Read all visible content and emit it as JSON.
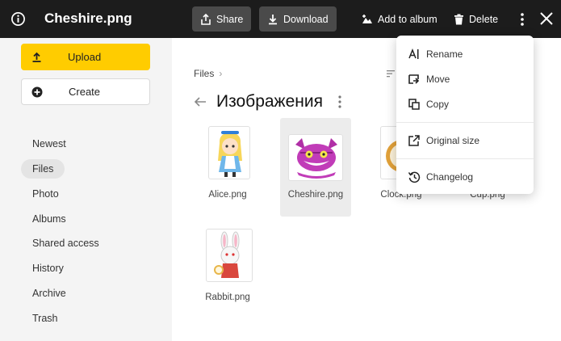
{
  "topbar": {
    "file_title": "Cheshire.png",
    "share_label": "Share",
    "download_label": "Download",
    "add_to_album_label": "Add to album",
    "delete_label": "Delete"
  },
  "sidebar": {
    "upload_label": "Upload",
    "create_label": "Create",
    "items": [
      {
        "label": "Newest",
        "active": false
      },
      {
        "label": "Files",
        "active": true
      },
      {
        "label": "Photo",
        "active": false
      },
      {
        "label": "Albums",
        "active": false
      },
      {
        "label": "Shared access",
        "active": false
      },
      {
        "label": "History",
        "active": false
      },
      {
        "label": "Archive",
        "active": false
      },
      {
        "label": "Trash",
        "active": false
      }
    ]
  },
  "main": {
    "breadcrumb": "Files",
    "breadcrumb_chevron": "›",
    "folder_title": "Изображения",
    "files": [
      {
        "name": "Alice.png",
        "selected": false
      },
      {
        "name": "Cheshire.png",
        "selected": true
      },
      {
        "name": "Clock.png",
        "selected": false
      },
      {
        "name": "Cup.png",
        "selected": false
      },
      {
        "name": "Rabbit.png",
        "selected": false
      }
    ]
  },
  "menu": {
    "items": [
      {
        "label": "Rename",
        "icon": "rename-icon"
      },
      {
        "label": "Move",
        "icon": "move-icon"
      },
      {
        "label": "Copy",
        "icon": "copy-icon"
      },
      {
        "label": "Original size",
        "icon": "external-link-icon"
      },
      {
        "label": "Changelog",
        "icon": "history-icon"
      }
    ]
  },
  "colors": {
    "topbar_bg": "#1c1c1c",
    "upload_yellow": "#ffcc00",
    "selected_tile": "#ececec"
  }
}
